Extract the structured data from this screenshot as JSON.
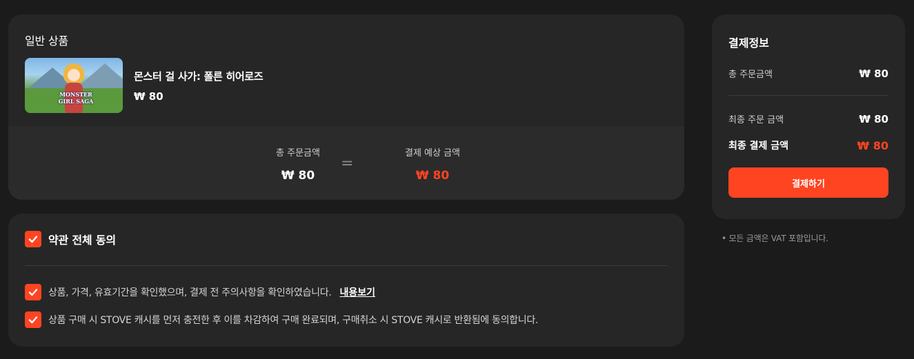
{
  "product": {
    "section_title": "일반 상품",
    "name": "몬스터 걸 사가: 폴른 히어로즈",
    "price": "₩ 80",
    "thumbnail_logo": "MONSTER GIRL SAGA"
  },
  "summary": {
    "total_label": "총 주문금액",
    "total_value": "₩ 80",
    "equals_sign": "=",
    "expected_label": "결제 예상 금액",
    "expected_value": "₩ 80"
  },
  "terms": {
    "all_label": "약관 전체 동의",
    "items": [
      {
        "text": "상품, 가격, 유효기간을 확인했으며, 결제 전 주의사항을 확인하였습니다.",
        "link": "내용보기"
      },
      {
        "text": "상품 구매 시 STOVE 캐시를 먼저 충전한 후 이를 차감하여 구매 완료되며, 구매취소 시 STOVE 캐시로 반환됨에 동의합니다."
      }
    ]
  },
  "payment": {
    "title": "결제정보",
    "total_label": "총 주문금액",
    "total_value": "₩ 80",
    "final_order_label": "최종 주문 금액",
    "final_order_value": "₩ 80",
    "final_pay_label": "최종 결제 금액",
    "final_pay_value": "₩ 80",
    "button_label": "결제하기",
    "vat_note": "• 모든 금액은 VAT 포함입니다."
  },
  "colors": {
    "accent": "#ff4422",
    "background": "#1b1b1b",
    "panel": "#262626"
  },
  "icons": {
    "checkbox": "check-icon"
  }
}
